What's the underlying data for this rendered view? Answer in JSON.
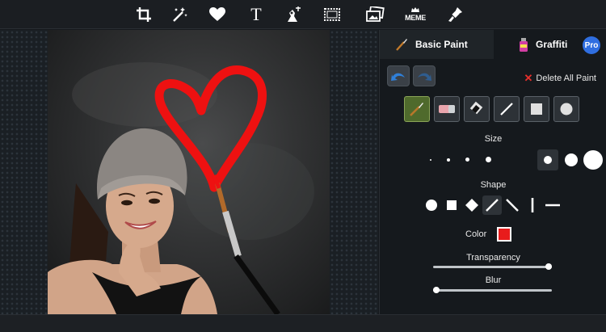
{
  "toolbar": {
    "items": [
      {
        "name": "crop-icon"
      },
      {
        "name": "magic-wand-icon"
      },
      {
        "name": "heart-icon"
      },
      {
        "name": "text-icon",
        "label": "T"
      },
      {
        "name": "distort-icon"
      },
      {
        "name": "frame-icon"
      },
      {
        "name": "photos-icon"
      },
      {
        "name": "meme-icon",
        "label": "MEME"
      },
      {
        "name": "paint-brush-icon"
      }
    ]
  },
  "panel": {
    "tabs": [
      {
        "label": "Basic Paint",
        "icon": "brush-icon",
        "active": true
      },
      {
        "label": "Graffiti",
        "icon": "spray-can-icon",
        "active": false,
        "badge": "Pro"
      }
    ],
    "delete_all_label": "Delete All Paint",
    "tools": [
      "brush-icon",
      "eraser-icon",
      "fill-icon",
      "line-icon",
      "square-icon",
      "circle-icon"
    ],
    "active_tool": "brush-icon",
    "size_label": "Size",
    "sizes_selected_index": 4,
    "shape_label": "Shape",
    "shapes": [
      "circle",
      "square",
      "diamond",
      "diagonal-right",
      "diagonal-left",
      "vertical",
      "horizontal"
    ],
    "shape_selected_index": 3,
    "color_label": "Color",
    "color_value": "#e81c1c",
    "transparency_label": "Transparency",
    "transparency_value": 1.0,
    "blur_label": "Blur",
    "blur_value": 0.0
  },
  "colors": {
    "accent_active_tool": "#4f6a2c",
    "pro_badge": "#2f6ee0",
    "delete_x": "#e8302c",
    "paint": "#e81c1c"
  }
}
